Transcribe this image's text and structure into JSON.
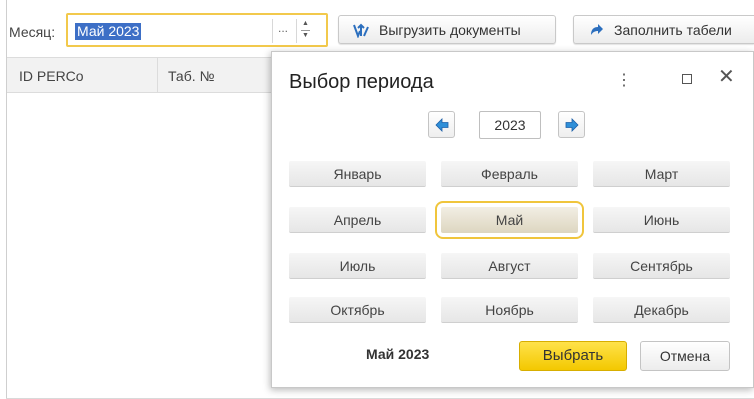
{
  "toolbar": {
    "month_label": "Месяц:",
    "month_value": "Май 2023",
    "ellipsis": "...",
    "export_button": "Выгрузить документы",
    "fill_button": "Заполнить табели"
  },
  "table": {
    "columns": [
      "ID PERCo",
      "Таб. №"
    ]
  },
  "dialog": {
    "title": "Выбор периода",
    "year": "2023",
    "months": [
      "Январь",
      "Февраль",
      "Март",
      "Апрель",
      "Май",
      "Июнь",
      "Июль",
      "Август",
      "Сентябрь",
      "Октябрь",
      "Ноябрь",
      "Декабрь"
    ],
    "selected_month": "Май",
    "selected_label": "Май 2023",
    "select_button": "Выбрать",
    "cancel_button": "Отмена"
  },
  "colors": {
    "accent_yellow": "#f2c94c",
    "selection_blue": "#3d6fc6",
    "nav_arrow_blue": "#2f8fd8",
    "primary_button": "#f7d21f"
  },
  "icons": {
    "export": "export-documents-icon",
    "fill": "fill-arrow-icon",
    "year_prev": "arrow-left-icon",
    "year_next": "arrow-right-icon",
    "more": "more-vertical-icon",
    "maximize": "maximize-icon",
    "close": "close-icon"
  }
}
